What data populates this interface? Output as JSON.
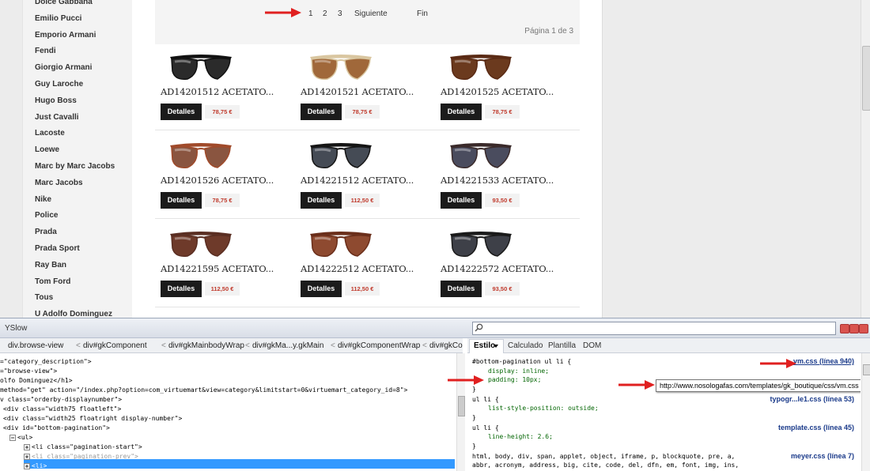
{
  "brands": [
    "Dolce Gabbana",
    "Emilio Pucci",
    "Emporio Armani",
    "Fendi",
    "Giorgio Armani",
    "Guy Laroche",
    "Hugo Boss",
    "Just Cavalli",
    "Lacoste",
    "Loewe",
    "Marc by Marc Jacobs",
    "Marc Jacobs",
    "Nike",
    "Police",
    "Prada",
    "Prada Sport",
    "Ray Ban",
    "Tom Ford",
    "Tous",
    "U Adolfo Dominguez"
  ],
  "pagination": {
    "pages": [
      "1",
      "2",
      "3"
    ],
    "next": "Siguiente",
    "last": "Fin",
    "info": "Página 1 de 3"
  },
  "products": [
    {
      "name": "AD14201512 ACETATO...",
      "price": "78,75 €",
      "button": "Detalles",
      "lens": "#2b2b2b",
      "frame": "#111111"
    },
    {
      "name": "AD14201521 ACETATO...",
      "price": "78,75 €",
      "button": "Detalles",
      "lens": "#a0683a",
      "frame": "#d9c6a0"
    },
    {
      "name": "AD14201525 ACETATO...",
      "price": "78,75 €",
      "button": "Detalles",
      "lens": "#6b3a1e",
      "frame": "#5a2a14"
    },
    {
      "name": "AD14201526 ACETATO...",
      "price": "78,75 €",
      "button": "Detalles",
      "lens": "#8a5540",
      "frame": "#a04a2a"
    },
    {
      "name": "AD14221512 ACETATO...",
      "price": "112,50 €",
      "button": "Detalles",
      "lens": "#454b55",
      "frame": "#151515"
    },
    {
      "name": "AD14221533 ACETATO...",
      "price": "93,50 €",
      "button": "Detalles",
      "lens": "#4a4c5e",
      "frame": "#3a2a2a"
    },
    {
      "name": "AD14221595 ACETATO...",
      "price": "112,50 €",
      "button": "Detalles",
      "lens": "#6e3a2a",
      "frame": "#5a2e22"
    },
    {
      "name": "AD14222512 ACETATO...",
      "price": "112,50 €",
      "button": "Detalles",
      "lens": "#8e4a30",
      "frame": "#6a2e1a"
    },
    {
      "name": "AD14222572 ACETATO...",
      "price": "93,50 €",
      "button": "Detalles",
      "lens": "#3e4048",
      "frame": "#1a1a1a"
    }
  ],
  "devtools": {
    "panel_title": "YSlow",
    "breadcrumbs": [
      "div.browse-view",
      "div#gkComponent",
      "div#gkMainbodyWrap",
      "div#gkMa...y.gkMain",
      "div#gkComponentWrap",
      "div#gkCo...y.gkM"
    ],
    "html_lines": [
      "=\"category_description\">",
      "=\"browse-view\">",
      "olfo Dominguez</h1>",
      "method=\"get\" action=\"/index.php?option=com_virtuemart&view=category&limitstart=0&virtuemart_category_id=8\">",
      "v class=\"orderby-displaynumber\">",
      "<div class=\"width75 floatleft\">",
      "<div class=\"width25 floatright display-number\">",
      "<div id=\"bottom-pagination\">",
      "<ul>",
      "<li class=\"pagination-start\">",
      "<li class=\"pagination-prev\">",
      "<li>"
    ],
    "style_tabs": [
      "Estilo",
      "Calculado",
      "Plantilla",
      "DOM"
    ],
    "css_rules": [
      {
        "selector": "#bottom-pagination ul li {",
        "props": [
          "display: inline;",
          "padding: 10px;"
        ],
        "source": "vm.css (línea 940)"
      },
      {
        "selector": "ul li {",
        "props": [
          "list-style-position: outside;"
        ],
        "source": "typogr...le1.css (línea 53)"
      },
      {
        "selector": "ul li {",
        "props": [
          "line-height: 2.6;"
        ],
        "source": "template.css (línea 45)"
      },
      {
        "selector": "html, body, div, span, applet, object, iframe, p, blockquote, pre, a,",
        "props": [
          "abbr, acronym, address, big, cite, code, del, dfn, em, font, img, ins,"
        ],
        "source": "meyer.css (línea 7)"
      }
    ],
    "tooltip": "http://www.nosologafas.com/templates/gk_boutique/css/vm.css"
  }
}
